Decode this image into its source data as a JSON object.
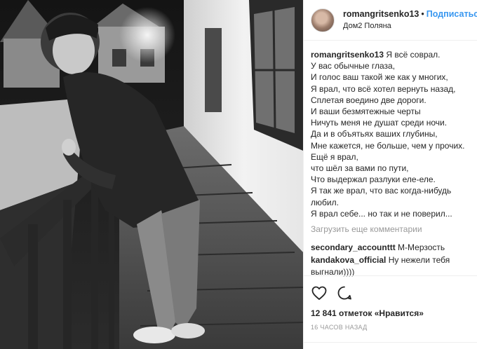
{
  "post": {
    "header": {
      "username": "romangritsenko13",
      "separator": "•",
      "follow_label": "Подписаться",
      "location": "Дом2 Поляна"
    },
    "caption": {
      "username": "romangritsenko13",
      "lines": [
        "Я всё соврал.",
        "У вас обычные глаза,",
        "И голос ваш такой же как у многих,",
        "Я врал, что всё хотел вернуть назад,",
        "Сплетая воедино две дороги.",
        "И ваши безмятежные черты",
        "Ничуть меня не душат среди ночи.",
        "Да и в объятьях ваших глубины,",
        "Мне кажется, не больше, чем у прочих.",
        "Ещё я врал,",
        "что шёл за вами по пути,",
        "Что выдержал разлуки еле-еле.",
        "Я так же врал, что вас когда-нибудь",
        "любил.",
        "Я врал себе... но так и не поверил..."
      ]
    },
    "load_more": "Загрузить еще комментарии",
    "comments": [
      {
        "username": "secondary_accounttt",
        "lines": [
          "М-Мерзость"
        ]
      },
      {
        "username": "kandakova_official",
        "lines": [
          "Ну нежели тебя",
          "выгнали))))"
        ]
      }
    ],
    "icons": {
      "like": "heart-outline-icon",
      "comment": "comment-bubble-icon"
    },
    "likes_text": "12 841 отметок «Нравится»",
    "timestamp": "16 часов назад",
    "colors": {
      "accent": "#3897f0",
      "muted": "#999999",
      "text": "#262626",
      "border": "#efefef"
    }
  }
}
